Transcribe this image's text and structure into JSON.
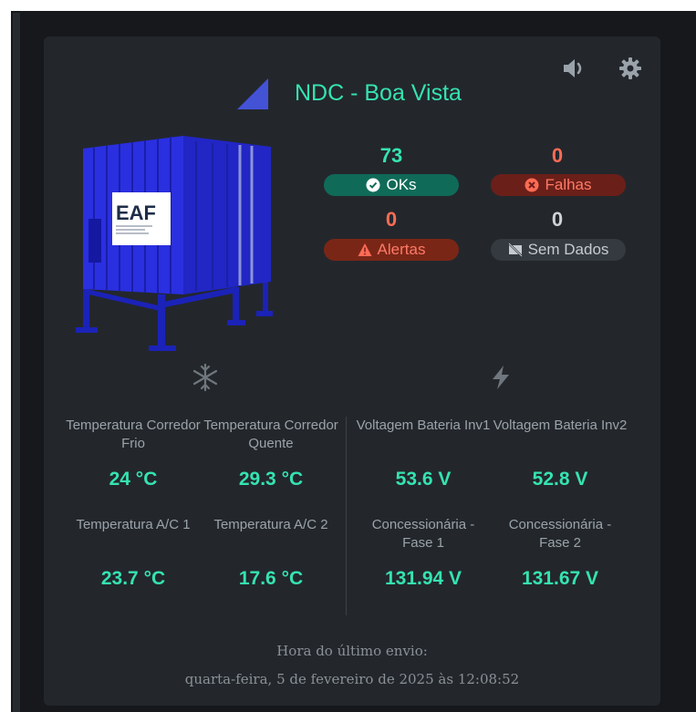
{
  "header": {
    "title": "NDC - Boa Vista",
    "icons": [
      "sound-icon",
      "gear-icon",
      "signal-triangle-icon"
    ]
  },
  "logo": {
    "text": "EAF"
  },
  "stats": {
    "oks": {
      "value": "73",
      "label": "OKs",
      "color": "#35e3b0"
    },
    "falhas": {
      "value": "0",
      "label": "Falhas",
      "color": "#ff6b55"
    },
    "alertas": {
      "value": "0",
      "label": "Alertas",
      "color": "#ff6b55"
    },
    "sem_dados": {
      "value": "0",
      "label": "Sem Dados",
      "color": "#cfd3d6"
    }
  },
  "sections": {
    "cooling_icon": "snowflake-icon",
    "power_icon": "lightning-icon"
  },
  "metrics": {
    "temp_corredor_frio": {
      "label": "Temperatura Corredor Frio",
      "value": "24 °C"
    },
    "temp_corredor_quente": {
      "label": "Temperatura Corredor Quente",
      "value": "29.3 °C"
    },
    "temp_ac1": {
      "label": "Temperatura A/C 1",
      "value": "23.7 °C"
    },
    "temp_ac2": {
      "label": "Temperatura A/C 2",
      "value": "17.6 °C"
    },
    "voltagem_inv1": {
      "label": "Voltagem Bateria Inv1",
      "value": "53.6 V"
    },
    "voltagem_inv2": {
      "label": "Voltagem Bateria Inv2",
      "value": "52.8 V"
    },
    "concessionaria_f1": {
      "label": "Concessionária - Fase 1",
      "value": "131.94 V"
    },
    "concessionaria_f2": {
      "label": "Concessionária - Fase 2",
      "value": "131.67 V"
    }
  },
  "footer": {
    "label": "Hora do último envio:",
    "timestamp": "quarta-feira, 5 de fevereiro de 2025 às 12:08:52"
  },
  "colors": {
    "accent": "#35e3b0",
    "ok_badge": "#0f6b58",
    "fail_badge": "#6b1f19",
    "alert_badge": "#7a2617",
    "nodata_badge": "#343a40"
  }
}
